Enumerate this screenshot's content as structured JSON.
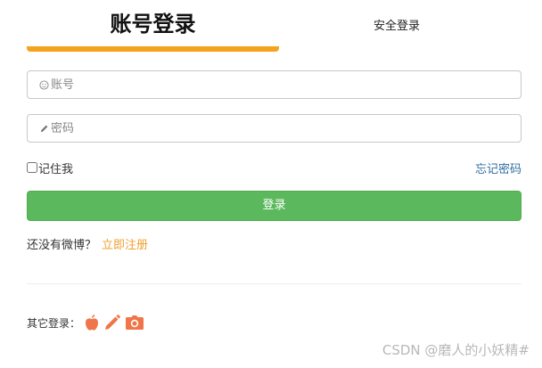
{
  "tabs": {
    "account_login": "账号登录",
    "secure_login": "安全登录",
    "active_color": "#f5a21e"
  },
  "form": {
    "username": {
      "placeholder": "账号",
      "icon": "user-icon"
    },
    "password": {
      "placeholder": "密码",
      "icon": "pencil-icon"
    },
    "remember_label": "记住我",
    "remember_checked": false,
    "forgot_label": "忘记密码",
    "submit_label": "登录",
    "submit_color": "#5cb85c"
  },
  "signup": {
    "prompt": "还没有微博？",
    "link_label": "立即注册",
    "link_color": "#f0a030"
  },
  "other_login": {
    "label": "其它登录：",
    "icons": [
      "apple-icon",
      "pencil-icon",
      "camera-icon"
    ],
    "icon_color": "#f0754a"
  },
  "watermark": "CSDN @磨人的小妖精#"
}
